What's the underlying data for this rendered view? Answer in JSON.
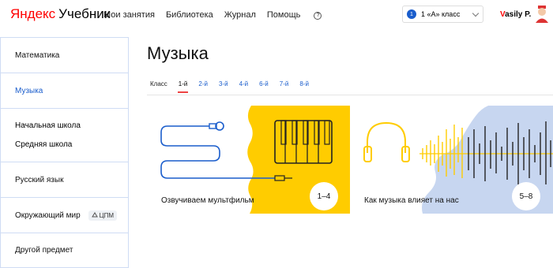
{
  "header": {
    "logo_yandex": "Яндекс",
    "logo_product": "Учебник",
    "nav": [
      "Мои занятия",
      "Библиотека",
      "Журнал",
      "Помощь"
    ],
    "help_icon": "?",
    "class_number": "1",
    "class_label": "1 «А» класс",
    "user_first_letter": "V",
    "user_name_rest": "asily P."
  },
  "sidebar": {
    "items": [
      {
        "label": "Математика"
      },
      {
        "label": "Музыка"
      },
      {
        "label": "Русский язык"
      },
      {
        "label": "Окружающий мир"
      },
      {
        "label": "Другой предмет"
      }
    ],
    "subitems": [
      "Начальная школа",
      "Средняя школа"
    ],
    "cpm_tag": "ЦПМ"
  },
  "main": {
    "title": "Музыка",
    "tabs_label": "Класс",
    "tabs": [
      "1-й",
      "2-й",
      "3-й",
      "4-й",
      "6-й",
      "7-й",
      "8-й"
    ],
    "active_tab": "1-й"
  },
  "cards": [
    {
      "title": "Озвучиваем мультфильм",
      "grades": "1–4",
      "color": "#ffcc00"
    },
    {
      "title": "Как музыка влияет на нас",
      "grades": "5–8",
      "color": "#c7d6f0"
    }
  ],
  "colors": {
    "accent": "#1a5dcc",
    "brand_red": "#ff0000",
    "border": "#cfdcf4"
  }
}
